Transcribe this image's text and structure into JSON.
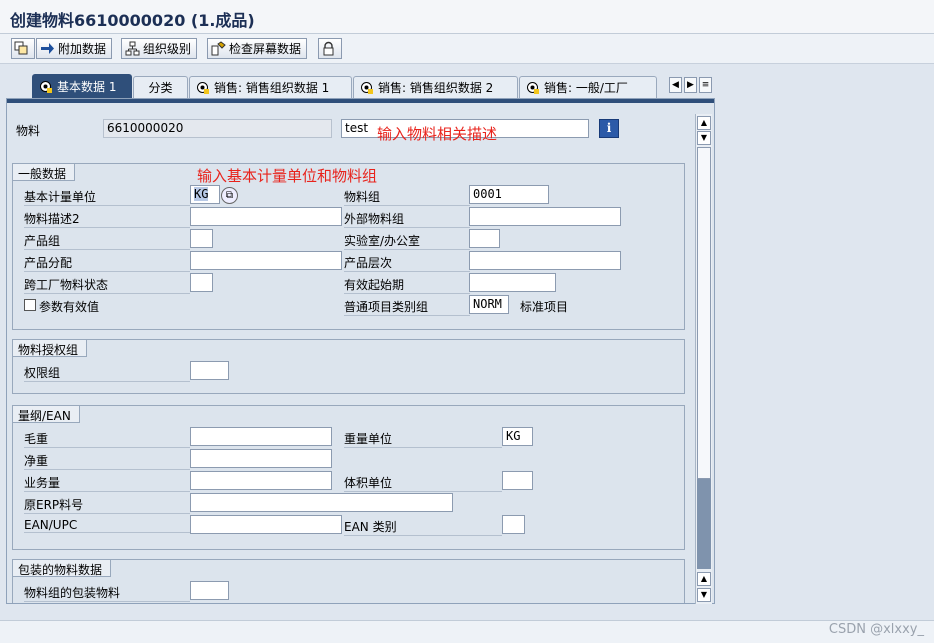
{
  "window": {
    "title": "创建物料6610000020 (1.成品)"
  },
  "toolbar": {
    "additional_data": "附加数据",
    "org_levels": "组织级别",
    "check_screen": "检查屏幕数据"
  },
  "tabs": [
    {
      "label": "基本数据 1",
      "active": true
    },
    {
      "label": "分类"
    },
    {
      "label": "销售: 销售组织数据 1"
    },
    {
      "label": "销售: 销售组织数据 2"
    },
    {
      "label": "销售: 一般/工厂"
    }
  ],
  "header": {
    "material_label": "物料",
    "material_value": "6610000020",
    "description_value": "test",
    "annotation_description": "输入物料相关描述"
  },
  "general": {
    "title": "一般数据",
    "annotation": "输入基本计量单位和物料组",
    "base_uom_label": "基本计量单位",
    "base_uom_value": "KG",
    "material_group_label": "物料组",
    "material_group_value": "0001",
    "desc2_label": "物料描述2",
    "ext_group_label": "外部物料组",
    "division_label": "产品组",
    "lab_office_label": "实验室/办公室",
    "product_alloc_label": "产品分配",
    "product_hierarchy_label": "产品层次",
    "cross_plant_status_label": "跨工厂物料状态",
    "valid_from_label": "有效起始期",
    "param_effect_label": "参数有效值",
    "gen_item_cat_label": "普通项目类别组",
    "gen_item_cat_value": "NORM",
    "gen_item_cat_text": "标准项目"
  },
  "auth": {
    "title": "物料授权组",
    "auth_group_label": "权限组"
  },
  "dims": {
    "title": "量纲/EAN",
    "gross_weight_label": "毛重",
    "weight_unit_label": "重量单位",
    "weight_unit_value": "KG",
    "net_weight_label": "净重",
    "volume_label": "业务量",
    "volume_unit_label": "体积单位",
    "legacy_no_label": "原ERP料号",
    "ean_label": "EAN/UPC",
    "ean_cat_label": "EAN 类别"
  },
  "packaging": {
    "title": "包装的物料数据",
    "pack_group_label": "物料组的包装物料"
  },
  "watermark": "CSDN @xlxxy_"
}
